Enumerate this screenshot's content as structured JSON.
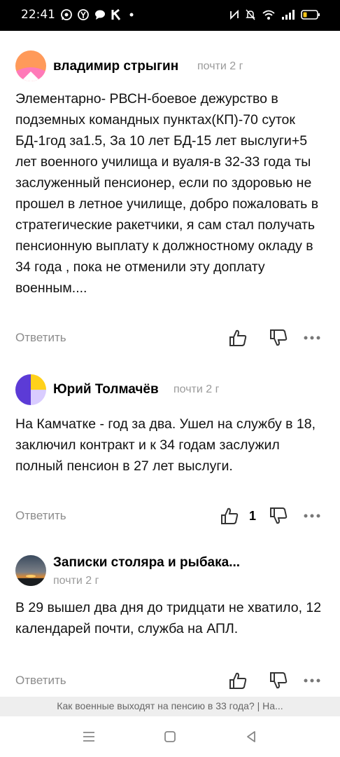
{
  "status_bar": {
    "time": "22:41",
    "left_icons": [
      "whatsapp-icon",
      "yandex-icon",
      "message-icon",
      "k-icon",
      "dot-icon"
    ],
    "right_icons": [
      "nfc-icon",
      "mute-icon",
      "wifi-icon",
      "signal-icon",
      "battery-icon"
    ]
  },
  "comments": [
    {
      "author": "владимир стрыгин",
      "time": "почти 2 г",
      "text": "Элементарно- РВСН-боевое дежурство в подземных командных пунктах(КП)-70 суток БД-1год за1.5, За 10 лет БД-15 лет выслуги+5 лет военного училища и вуаля-в 32-33 года ты заслуженный пенсионер, если по здоровью не прошел в летное училище, добро пожаловать в стратегические ракетчики, я сам стал получать пенсионную выплату к должностному окладу в 34 года , пока не отменили эту доплату военным....",
      "reply": "Ответить",
      "likes": ""
    },
    {
      "author": "Юрий Толмачёв",
      "time": "почти 2 г",
      "text": "На Камчатке - год за два. Ушел на службу в 18, заключил контракт и к 34 годам заслужил полный пенсион в 27 лет выслуги.",
      "reply": "Ответить",
      "likes": "1"
    },
    {
      "author": "Записки столяра и рыбака...",
      "time": "почти 2 г",
      "text": "В 29 вышел два дня до тридцати не хватило, 12 календарей почти, служба на АПЛ.",
      "reply": "Ответить",
      "likes": ""
    }
  ],
  "bottom_bar": {
    "title": "Как военные выходят на пенсию в 33 года? | На..."
  },
  "nav": [
    "menu-icon",
    "home-icon",
    "back-icon"
  ]
}
